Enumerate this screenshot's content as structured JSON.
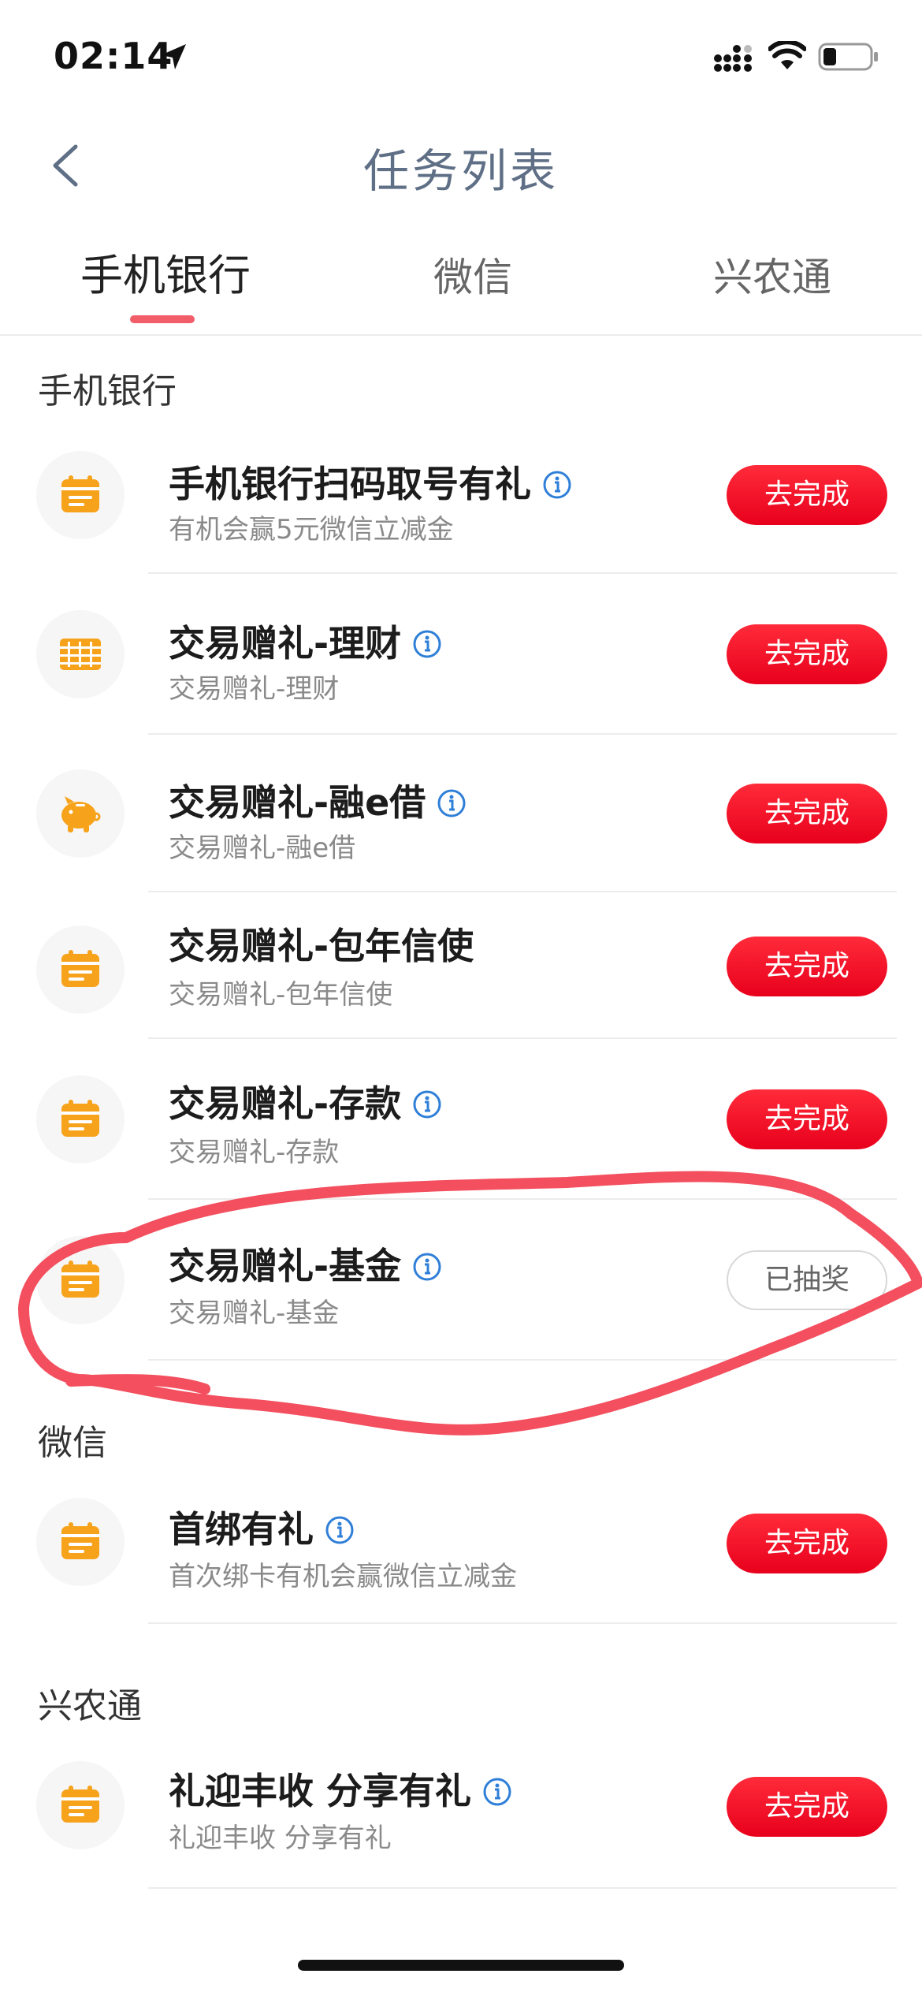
{
  "status_bar": {
    "time": "02:14"
  },
  "nav": {
    "title": "任务列表"
  },
  "tabs": [
    {
      "label": "手机银行",
      "active": true
    },
    {
      "label": "微信",
      "active": false
    },
    {
      "label": "兴农通",
      "active": false
    }
  ],
  "sections": {
    "mobile_bank": {
      "title": "手机银行",
      "tasks": [
        {
          "title": "手机银行扫码取号有礼",
          "subtitle": "有机会赢5元微信立减金",
          "button": "去完成",
          "icon": "calendar-icon",
          "info": true
        },
        {
          "title": "交易赠礼-理财",
          "subtitle": "交易赠礼-理财",
          "button": "去完成",
          "icon": "abacus-icon",
          "info": true
        },
        {
          "title": "交易赠礼-融e借",
          "subtitle": "交易赠礼-融e借",
          "button": "去完成",
          "icon": "piggy-bank-icon",
          "info": true
        },
        {
          "title": "交易赠礼-包年信使",
          "subtitle": "交易赠礼-包年信使",
          "button": "去完成",
          "icon": "calendar-icon",
          "info": false
        },
        {
          "title": "交易赠礼-存款",
          "subtitle": "交易赠礼-存款",
          "button": "去完成",
          "icon": "calendar-icon",
          "info": true
        },
        {
          "title": "交易赠礼-基金",
          "subtitle": "交易赠礼-基金",
          "button": "已抽奖",
          "icon": "calendar-icon",
          "info": true
        }
      ]
    },
    "wechat": {
      "title": "微信",
      "tasks": [
        {
          "title": "首绑有礼",
          "subtitle": "首次绑卡有机会赢微信立减金",
          "button": "去完成",
          "icon": "calendar-icon",
          "info": true
        }
      ]
    },
    "xingnongtong": {
      "title": "兴农通",
      "tasks": [
        {
          "title": "礼迎丰收 分享有礼",
          "subtitle": "礼迎丰收 分享有礼",
          "button": "去完成",
          "icon": "calendar-icon",
          "info": true
        }
      ]
    }
  },
  "colors": {
    "accent_red": "#e8001c",
    "tab_indicator": "#f25d6a",
    "icon_orange": "#f7a21b",
    "info_blue": "#2f7fd8",
    "annotation_red": "#f24050"
  }
}
